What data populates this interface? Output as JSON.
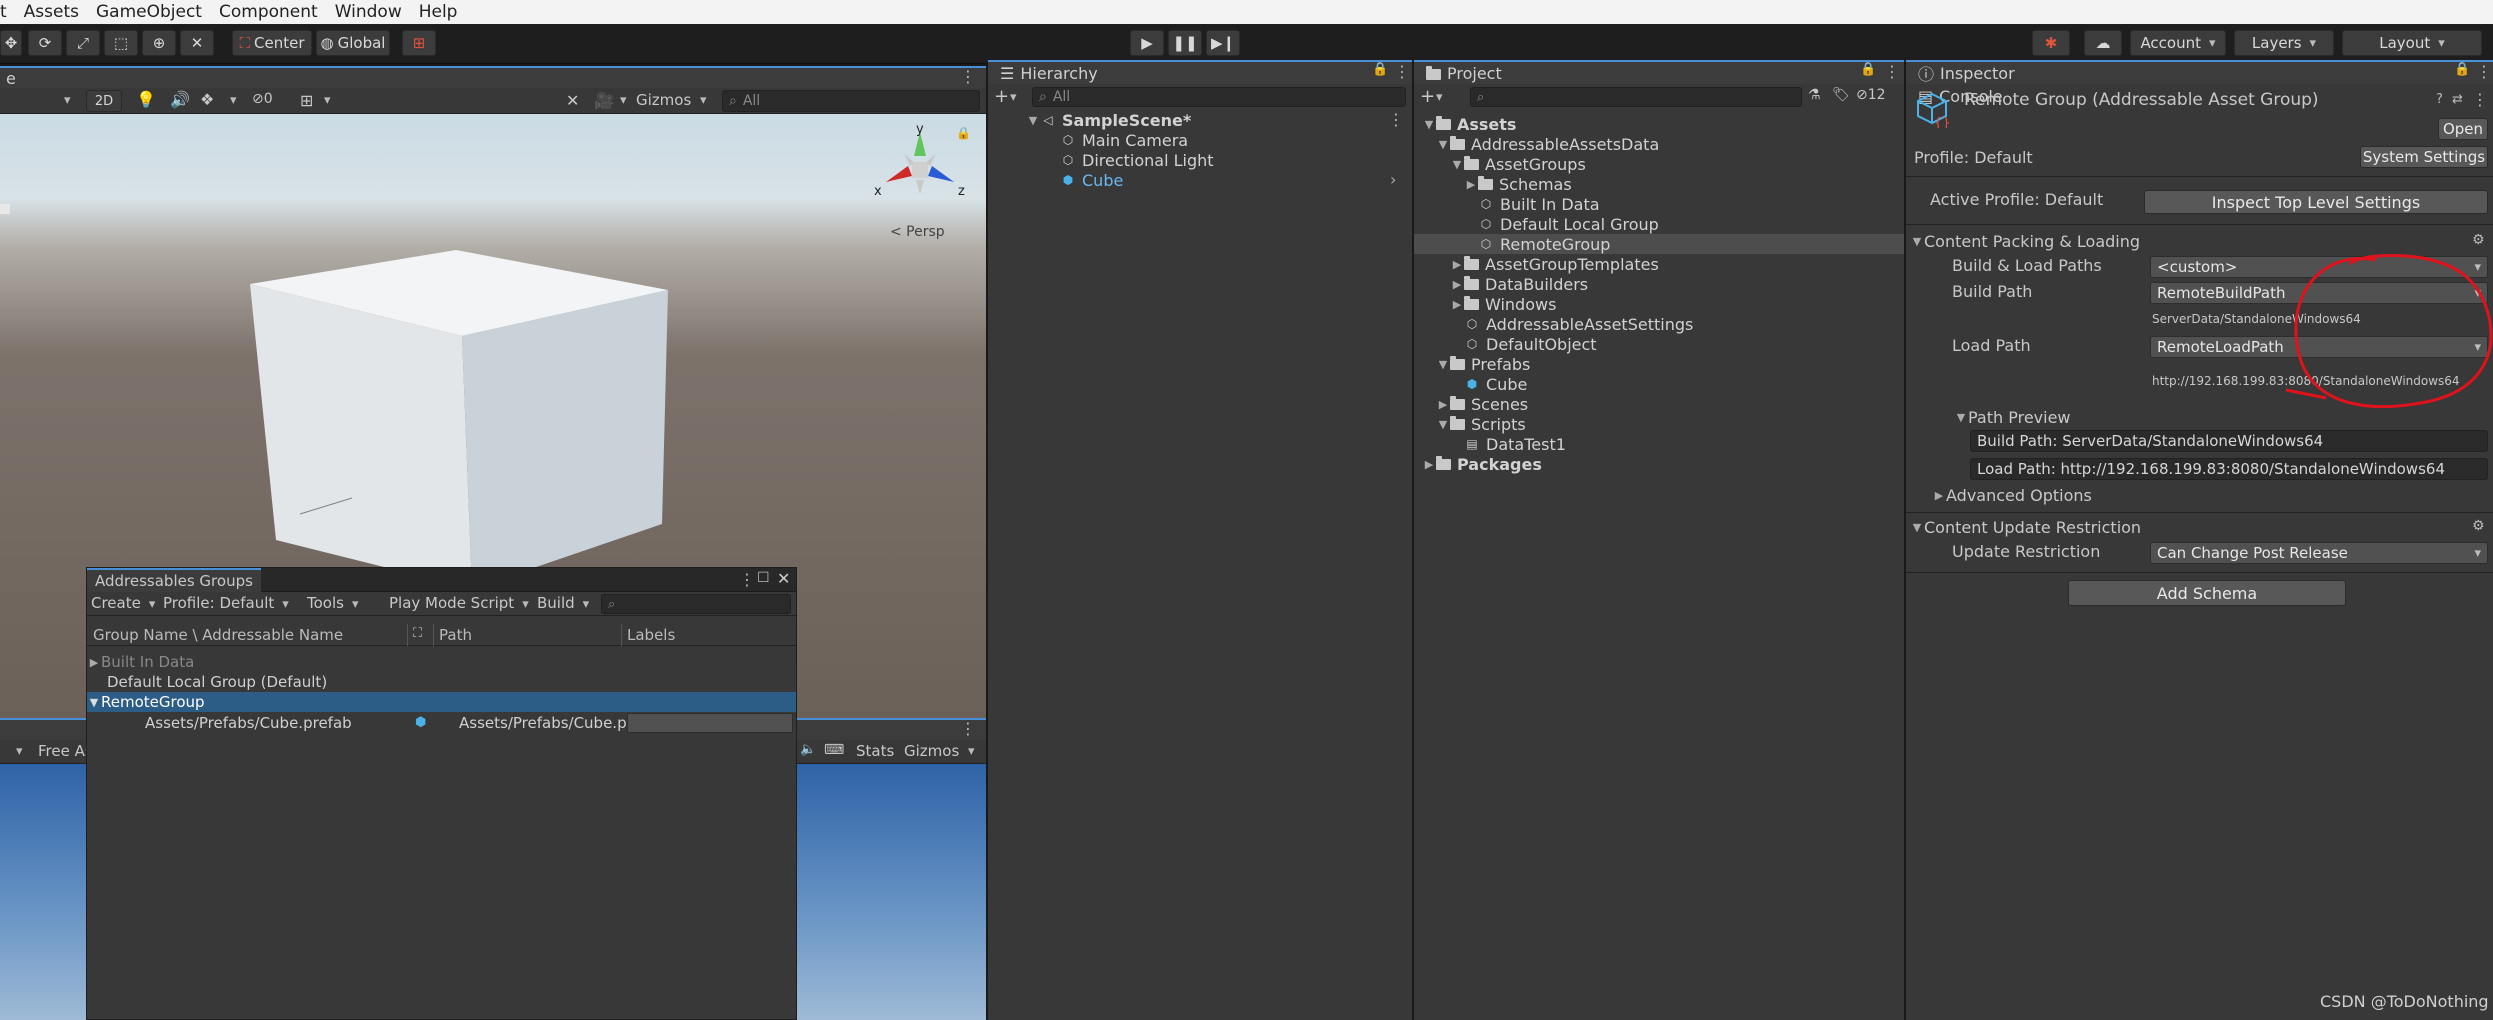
{
  "menu": [
    "t",
    "Assets",
    "GameObject",
    "Component",
    "Window",
    "Help"
  ],
  "toolbar": {
    "center_label": "Center",
    "global_label": "Global",
    "account_label": "Account",
    "layers_label": "Layers",
    "layout_label": "Layout"
  },
  "scene": {
    "tab_label": "e",
    "mode_2d": "2D",
    "hidden_count": "0",
    "gizmos_label": "Gizmos",
    "search_placeholder": "All",
    "persp_label": "< Persp",
    "axis_x": "x",
    "axis_y": "y",
    "axis_z": "z"
  },
  "game": {
    "free_aspect": "Free As",
    "stats_label": "Stats",
    "gizmos_label": "Gizmos"
  },
  "addressables": {
    "title": "Addressables Groups",
    "toolbar": [
      "Create",
      "Profile: Default",
      "Tools",
      "Play Mode Script",
      "Build"
    ],
    "columns": {
      "name": "Group Name \\ Addressable Name",
      "path": "Path",
      "labels": "Labels"
    },
    "rows": {
      "built_in": "Built In Data",
      "default_local": "Default Local Group (Default)",
      "remote_group": "RemoteGroup",
      "asset_name": "Assets/Prefabs/Cube.prefab",
      "asset_path": "Assets/Prefabs/Cube.p"
    }
  },
  "hierarchy": {
    "tab_label": "Hierarchy",
    "search_placeholder": "All",
    "scene_name": "SampleScene*",
    "items": [
      "Main Camera",
      "Directional Light",
      "Cube"
    ]
  },
  "project": {
    "tab_label": "Project",
    "hidden_count": "12",
    "tree": {
      "assets": "Assets",
      "addressable_data": "AddressableAssetsData",
      "asset_groups": "AssetGroups",
      "schemas": "Schemas",
      "built_in": "Built In Data",
      "default_local": "Default Local Group",
      "remote_group": "RemoteGroup",
      "templates": "AssetGroupTemplates",
      "data_builders": "DataBuilders",
      "windows": "Windows",
      "settings": "AddressableAssetSettings",
      "default_object": "DefaultObject",
      "prefabs": "Prefabs",
      "cube": "Cube",
      "scenes": "Scenes",
      "scripts": "Scripts",
      "data_test": "DataTest1",
      "packages": "Packages"
    }
  },
  "inspector": {
    "tab_inspector": "Inspector",
    "tab_console": "Console",
    "title": "Remote Group (Addressable Asset Group)",
    "open_label": "Open",
    "profile_label": "Profile: Default",
    "system_settings": "System Settings",
    "active_profile": "Active Profile: Default",
    "inspect_top": "Inspect Top Level Settings",
    "content_packing": "Content Packing & Loading",
    "build_load_paths_label": "Build & Load Paths",
    "build_load_paths_value": "<custom>",
    "build_path_label": "Build Path",
    "build_path_value": "RemoteBuildPath",
    "build_path_resolved": "ServerData/StandaloneWindows64",
    "load_path_label": "Load Path",
    "load_path_value": "RemoteLoadPath",
    "load_path_resolved": "http://192.168.199.83:8080/StandaloneWindows64",
    "path_preview": "Path Preview",
    "preview_build": "Build Path: ServerData/StandaloneWindows64",
    "preview_load": "Load Path: http://192.168.199.83:8080/StandaloneWindows64",
    "advanced": "Advanced Options",
    "content_update": "Content Update Restriction",
    "update_restriction_label": "Update Restriction",
    "update_restriction_value": "Can Change Post Release",
    "add_schema": "Add Schema"
  },
  "watermark": "CSDN @ToDoNothing",
  "colors": {
    "accent": "#4a90d9",
    "selection": "#2c5d87",
    "annotation": "#e0121b"
  }
}
